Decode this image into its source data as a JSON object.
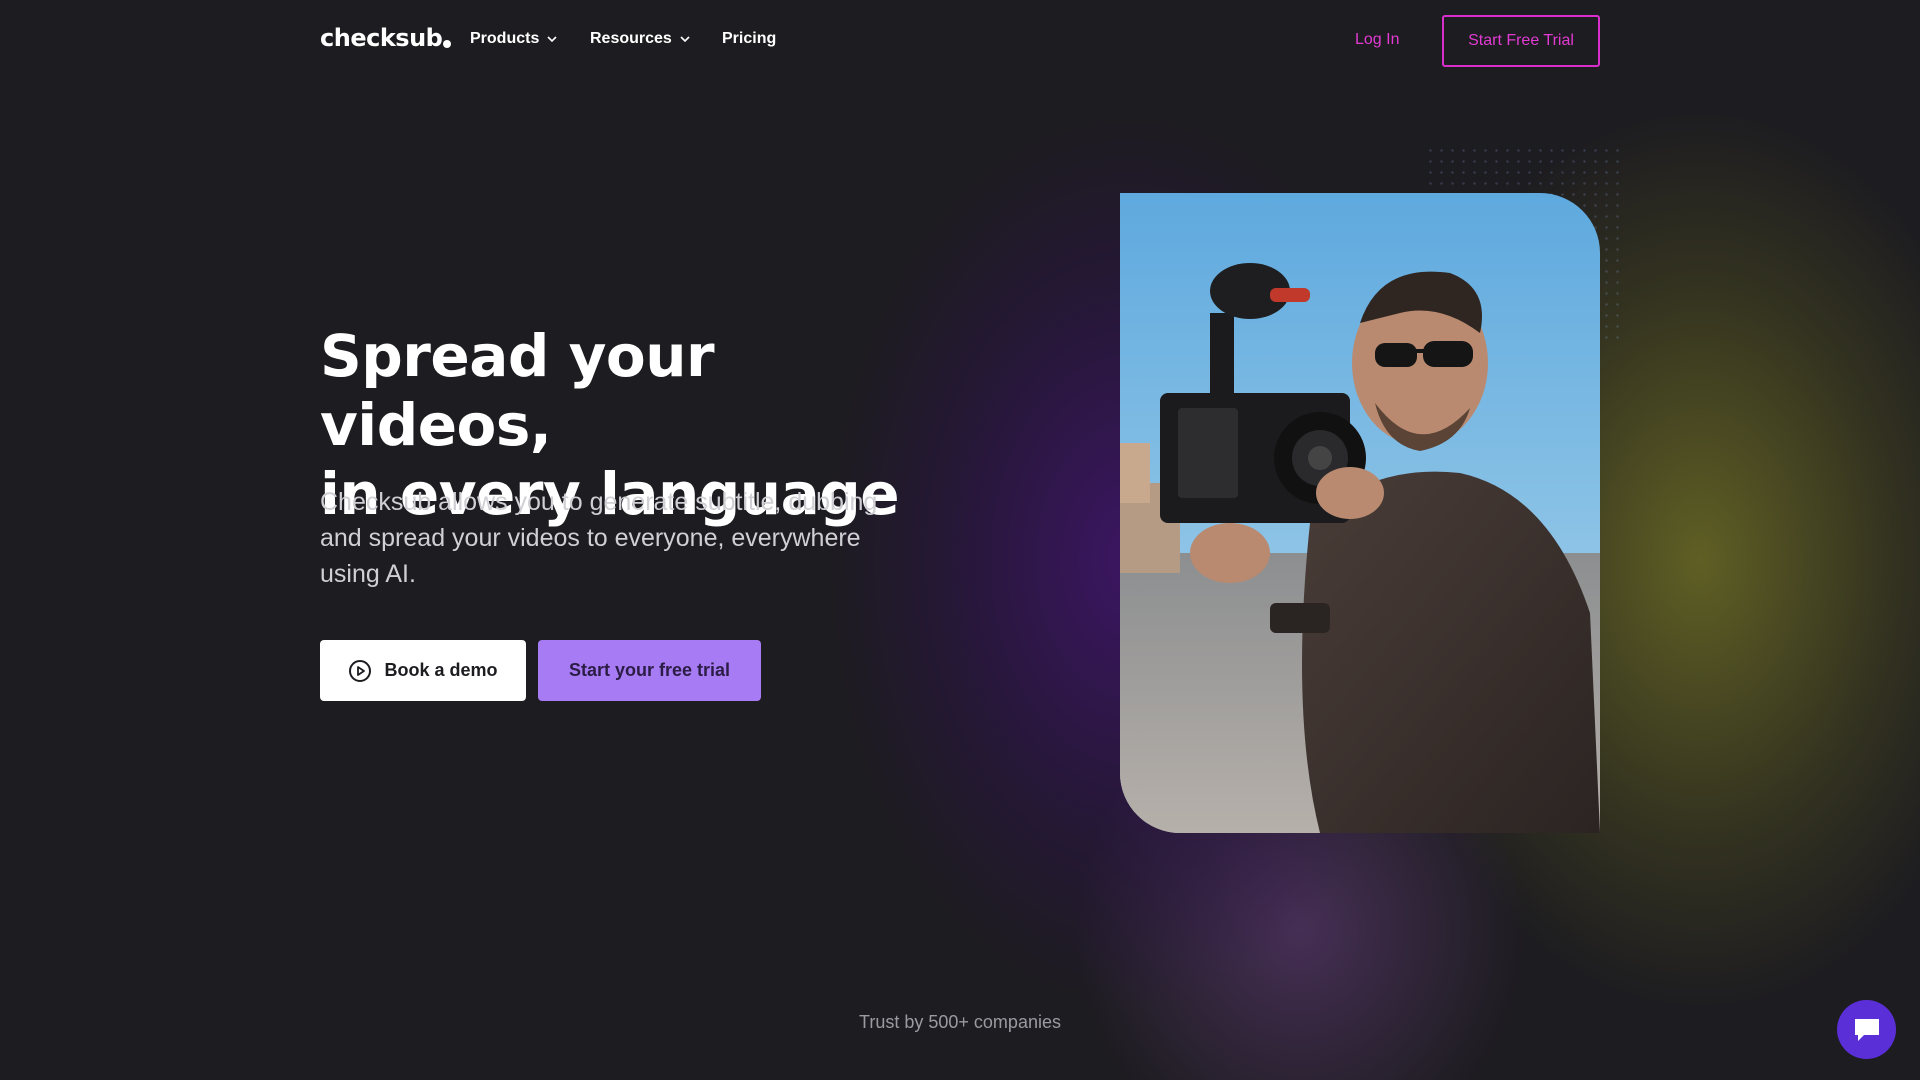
{
  "brand": {
    "logo_text": "checksub"
  },
  "nav": {
    "items": [
      {
        "label": "Products",
        "has_dropdown": true
      },
      {
        "label": "Resources",
        "has_dropdown": true
      },
      {
        "label": "Pricing",
        "has_dropdown": false
      }
    ],
    "login_label": "Log In",
    "trial_label": "Start Free Trial"
  },
  "hero": {
    "title_line1": "Spread your videos,",
    "title_line2": "in every language",
    "subtitle": "Checksub allows you to generate subtitle, dubbing and spread your videos to everyone, everywhere using AI.",
    "demo_button": "Book a demo",
    "trial_button": "Start your free trial",
    "image_alt": "Man filming with a camera rig"
  },
  "footer": {
    "trust_text": "Trust by 500+ companies"
  },
  "icons": {
    "chevron": "chevron-down-icon",
    "play": "play-circle-icon",
    "chat": "chat-bubble-icon"
  },
  "colors": {
    "background": "#1d1c20",
    "accent_pink": "#e23bd3",
    "accent_purple": "#a77bf3",
    "chat_button": "#5b2fd8"
  }
}
